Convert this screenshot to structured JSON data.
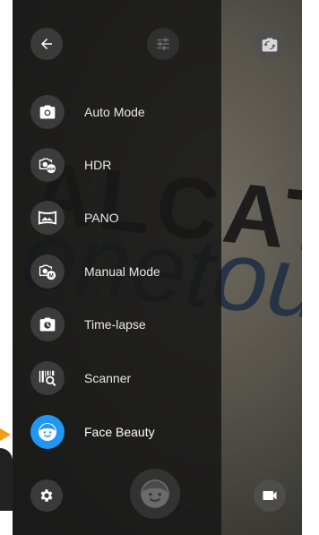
{
  "modes": [
    {
      "label": "Auto Mode",
      "icon": "camera-icon"
    },
    {
      "label": "HDR",
      "icon": "hdr-icon"
    },
    {
      "label": "PANO",
      "icon": "panorama-icon"
    },
    {
      "label": "Manual Mode",
      "icon": "manual-mode-icon"
    },
    {
      "label": "Time-lapse",
      "icon": "time-lapse-icon"
    },
    {
      "label": "Scanner",
      "icon": "scanner-icon"
    },
    {
      "label": "Face Beauty",
      "icon": "face-beauty-icon",
      "selected": true
    }
  ],
  "viewfinder": {
    "brand": "ALCATEL",
    "brand_sub": "onetouch."
  },
  "colors": {
    "accent": "#2196f3",
    "pointer": "#f39c12"
  }
}
